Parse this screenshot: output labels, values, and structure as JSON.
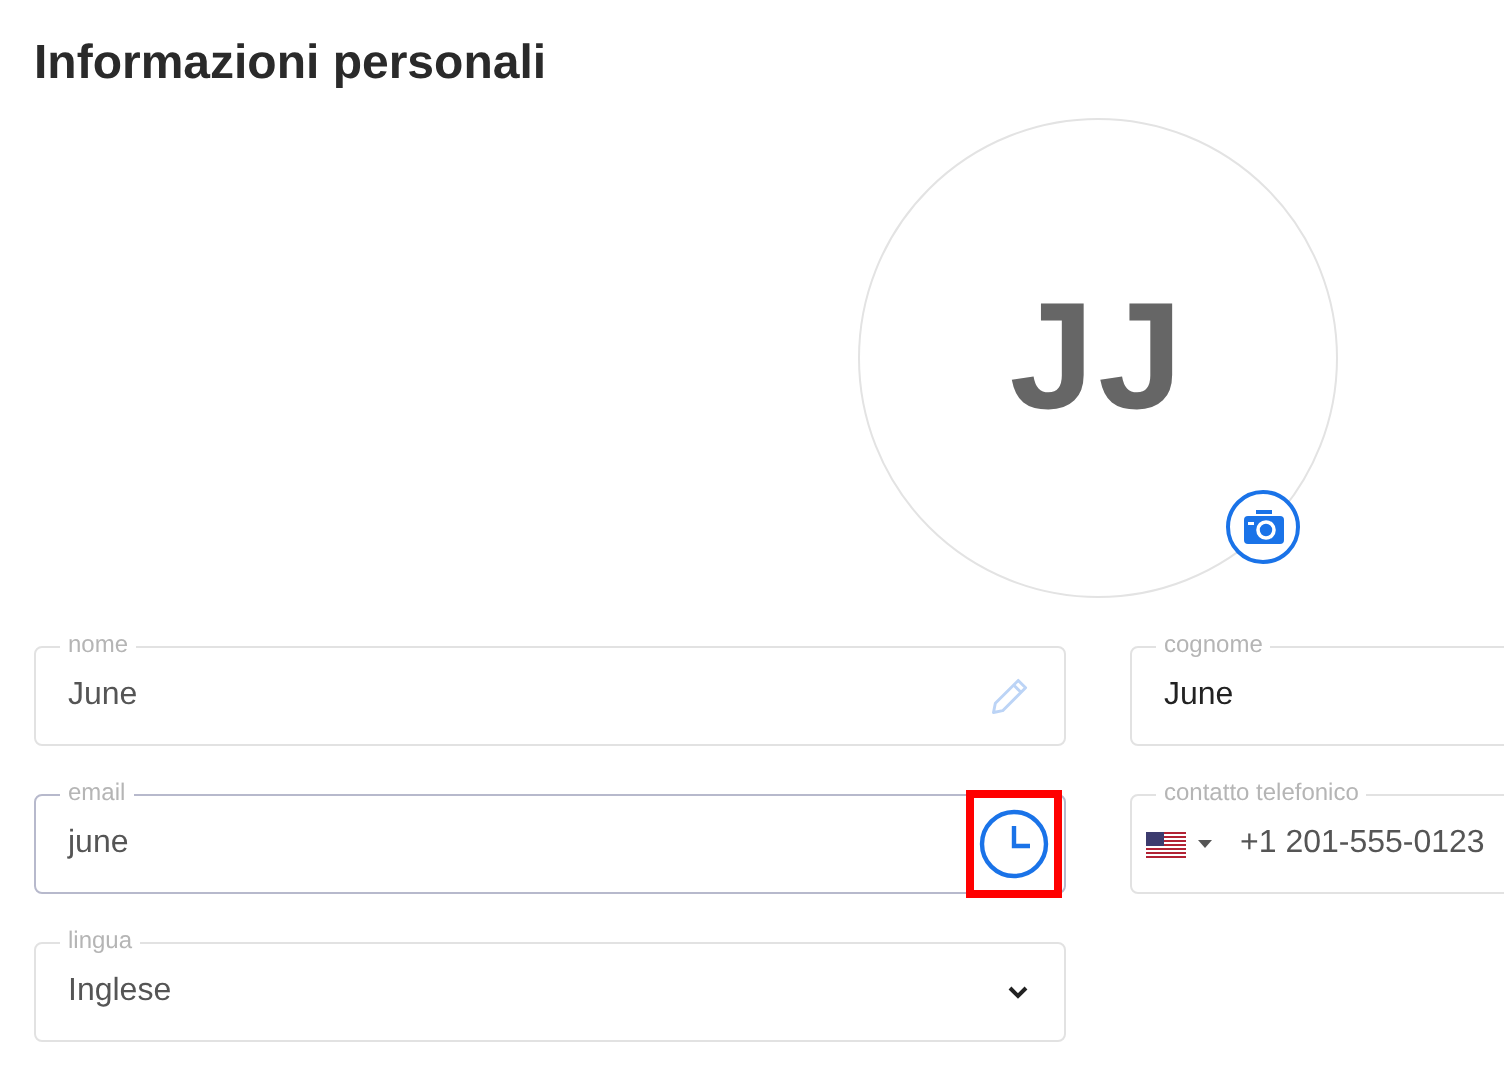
{
  "title": "Informazioni personali",
  "avatar": {
    "initials": "JJ"
  },
  "rows": [
    [
      {
        "kind": "editable",
        "label": "nome",
        "value": "June",
        "focused": false
      },
      {
        "kind": "text",
        "label": "cognome",
        "value": "June",
        "focused": false
      }
    ],
    [
      {
        "kind": "email",
        "label": "email",
        "value": "june",
        "focused": true,
        "highlighted": true
      },
      {
        "kind": "phone",
        "label": "contatto telefonico",
        "value": "+1 201-555-0123",
        "focused": false
      }
    ],
    [
      {
        "kind": "select",
        "label": "lingua",
        "value": "Inglese",
        "focused": false
      }
    ]
  ]
}
